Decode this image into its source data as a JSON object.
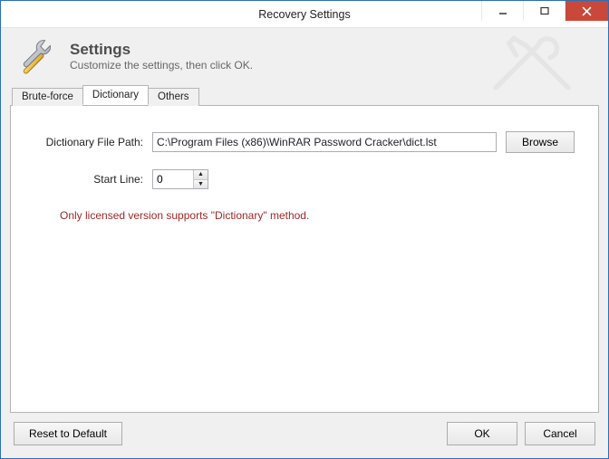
{
  "window": {
    "title": "Recovery Settings"
  },
  "header": {
    "title": "Settings",
    "subtitle": "Customize the settings, then click OK."
  },
  "tabs": {
    "brute_force": "Brute-force",
    "dictionary": "Dictionary",
    "others": "Others",
    "active": "dictionary"
  },
  "panel": {
    "path_label": "Dictionary File Path:",
    "path_value": "C:\\Program Files (x86)\\WinRAR Password Cracker\\dict.lst",
    "browse_label": "Browse",
    "startline_label": "Start Line:",
    "startline_value": "0",
    "license_note": "Only licensed version supports \"Dictionary\" method."
  },
  "footer": {
    "reset_label": "Reset to Default",
    "ok_label": "OK",
    "cancel_label": "Cancel"
  },
  "icons": {
    "tools": "tools-icon",
    "minimize": "minimize-icon",
    "maximize": "maximize-icon",
    "close": "close-icon",
    "spinner_up": "spinner-up-icon",
    "spinner_down": "spinner-down-icon"
  }
}
